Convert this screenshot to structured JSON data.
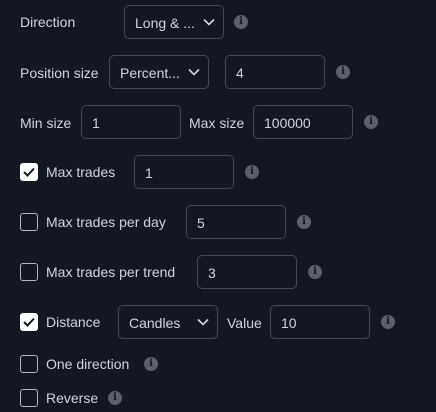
{
  "direction": {
    "label": "Direction",
    "value": "Long & ..."
  },
  "position_size": {
    "label": "Position size",
    "type_value": "Percent...",
    "value": "4"
  },
  "min_size": {
    "label": "Min size",
    "value": "1"
  },
  "max_size": {
    "label": "Max size",
    "value": "100000"
  },
  "max_trades": {
    "label": "Max trades",
    "checked": true,
    "value": "1"
  },
  "max_trades_per_day": {
    "label": "Max trades per day",
    "checked": false,
    "value": "5"
  },
  "max_trades_per_trend": {
    "label": "Max trades per trend",
    "checked": false,
    "value": "3"
  },
  "distance": {
    "label": "Distance",
    "checked": true,
    "type_value": "Candles",
    "value_label": "Value",
    "value": "10"
  },
  "one_direction": {
    "label": "One direction",
    "checked": false
  },
  "reverse": {
    "label": "Reverse",
    "checked": false
  },
  "colors": {
    "background": "#131722",
    "border": "#434651",
    "text": "#d1d4dc",
    "info_icon": "#5d606b"
  },
  "icons": [
    "info-icon",
    "chevron-down-icon",
    "checkmark-icon"
  ]
}
